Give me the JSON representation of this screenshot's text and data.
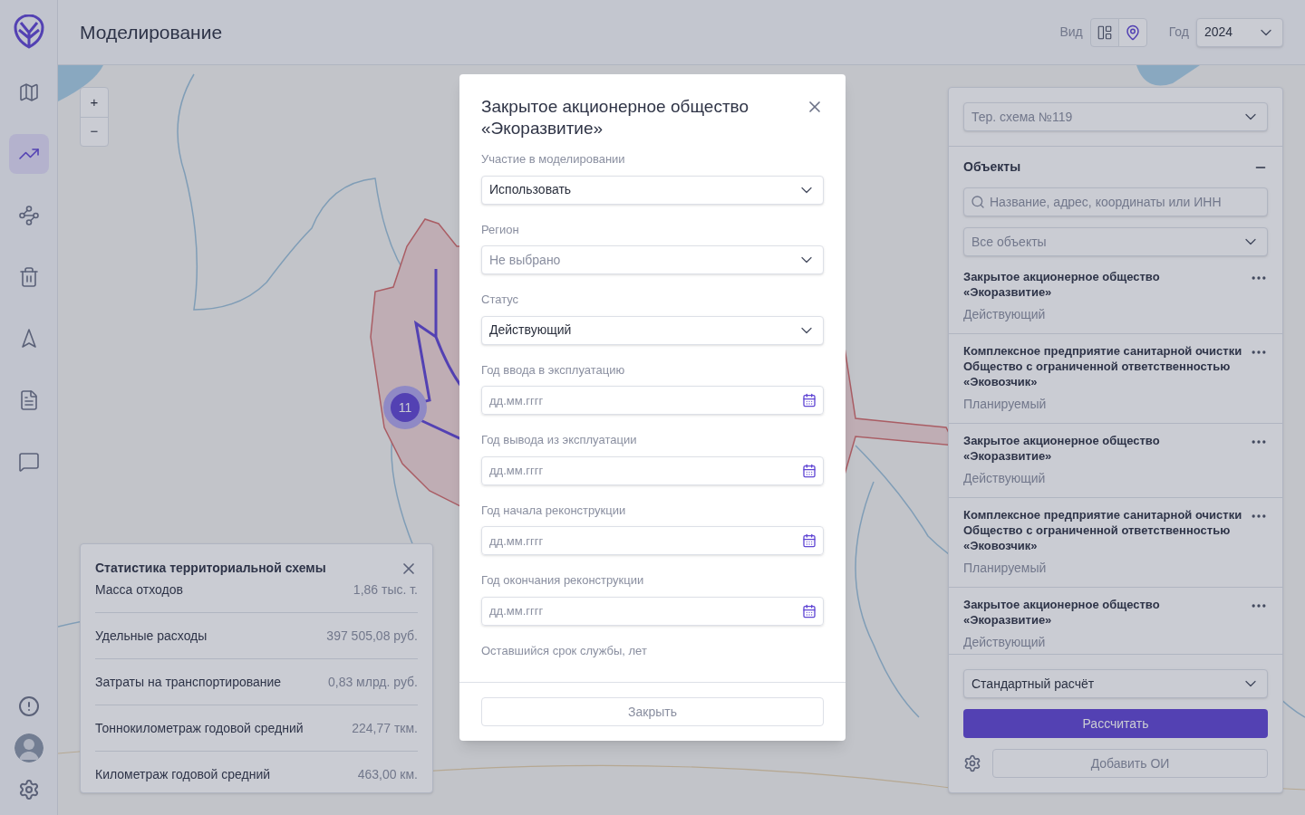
{
  "header": {
    "title": "Моделирование",
    "view_label": "Вид",
    "view_buttons": [
      {
        "kind": "layout",
        "selected": false
      },
      {
        "kind": "pin",
        "selected": true
      }
    ],
    "year_label": "Год",
    "year": "2024"
  },
  "sidebar": {
    "items": [
      {
        "kind": "map",
        "selected": false
      },
      {
        "kind": "chart",
        "selected": true
      },
      {
        "kind": "route",
        "selected": false
      },
      {
        "kind": "trash",
        "selected": false
      },
      {
        "kind": "navigation",
        "selected": false
      },
      {
        "kind": "document",
        "selected": false
      },
      {
        "kind": "chat",
        "selected": false
      }
    ],
    "bottom": [
      {
        "kind": "alert"
      },
      {
        "kind": "avatar"
      },
      {
        "kind": "settings"
      }
    ]
  },
  "map": {
    "zoom_buttons": [
      "+",
      "−"
    ],
    "cluster": "11"
  },
  "stats": {
    "title": "Статистика территориальной схемы",
    "rows": [
      {
        "label": "Масса отходов",
        "value": "1,86 тыс. т."
      },
      {
        "label": "Удельные расходы",
        "value": "397 505,08 руб."
      },
      {
        "label": "Затраты на транспортирование",
        "value": "0,83 млрд. руб."
      },
      {
        "label": "Тоннокилометраж годовой средний",
        "value": "224,77 ткм."
      },
      {
        "label": "Километраж годовой средний",
        "value": "463,00 км."
      }
    ]
  },
  "panel": {
    "scheme": "Тер. схема №119",
    "objects_title": "Объекты",
    "search_placeholder": "Название, адрес, координаты или ИНН",
    "filter": "Все объекты",
    "items": [
      {
        "name": "Закрытое акционерное общество «Экоразвитие»",
        "status": "Действующий"
      },
      {
        "name": "Комплексное предприятие санитарной очистки Общество с ограниченной ответственностью «Эковозчик»",
        "status": "Планируемый"
      },
      {
        "name": "Закрытое акционерное общество «Экоразвитие»",
        "status": "Действующий"
      },
      {
        "name": "Комплексное предприятие санитарной очистки Общество с ограниченной ответственностью «Эковозчик»",
        "status": "Планируемый"
      },
      {
        "name": "Закрытое акционерное общество «Экоразвитие»",
        "status": "Действующий"
      }
    ],
    "calc_mode": "Стандартный расчёт",
    "calculate": "Рассчитать",
    "add": "Добавить ОИ"
  },
  "modal": {
    "title": "Закрытое акционерное общество «Экоразвитие»",
    "fields": [
      {
        "kind": "select",
        "label": "Участие в моделировании",
        "value": "Использовать"
      },
      {
        "kind": "select",
        "label": "Регион",
        "placeholder": "Не выбрано"
      },
      {
        "kind": "select",
        "label": "Статус",
        "value": "Действующий"
      },
      {
        "kind": "date",
        "label": "Год ввода в эксплуатацию",
        "placeholder": "дд.мм.гггг"
      },
      {
        "kind": "date",
        "label": "Год вывода из эксплуатации",
        "placeholder": "дд.мм.гггг"
      },
      {
        "kind": "date",
        "label": "Год начала реконструкции",
        "placeholder": "дд.мм.гггг"
      },
      {
        "kind": "date",
        "label": "Год окончания реконструкции",
        "placeholder": "дд.мм.гггг"
      },
      {
        "kind": "label",
        "label": "Оставшийся срок службы, лет"
      }
    ],
    "close": "Закрыть"
  }
}
